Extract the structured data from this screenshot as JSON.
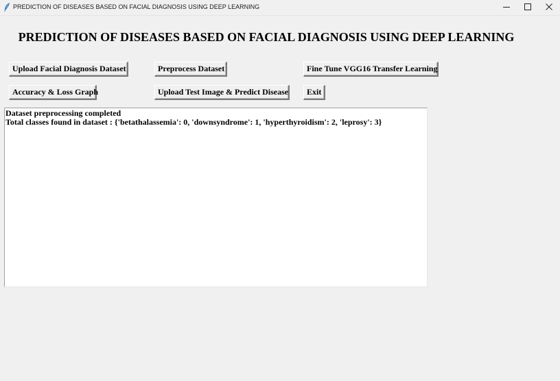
{
  "window": {
    "title": "PREDICTION OF DISEASES BASED ON FACIAL DIAGNOSIS USING DEEP LEARNING",
    "icon": "feather-icon",
    "controls": [
      "minimize-icon",
      "maximize-icon",
      "close-icon"
    ]
  },
  "main": {
    "heading": "PREDICTION OF DISEASES BASED ON FACIAL DIAGNOSIS USING DEEP LEARNING"
  },
  "buttons": {
    "upload_dataset": "Upload Facial Diagnosis Dataset",
    "preprocess": "Preprocess Dataset",
    "finetune": "Fine Tune VGG16 Transfer Learning",
    "graph": "Accuracy & Loss Graph",
    "predict": "Upload Test Image & Predict Disease",
    "exit": "Exit"
  },
  "output": {
    "lines": [
      "Dataset preprocessing completed",
      "Total classes found in dataset : {'betathalassemia': 0, 'downsyndrome': 1, 'hyperthyroidism': 2, 'leprosy': 3}"
    ]
  }
}
